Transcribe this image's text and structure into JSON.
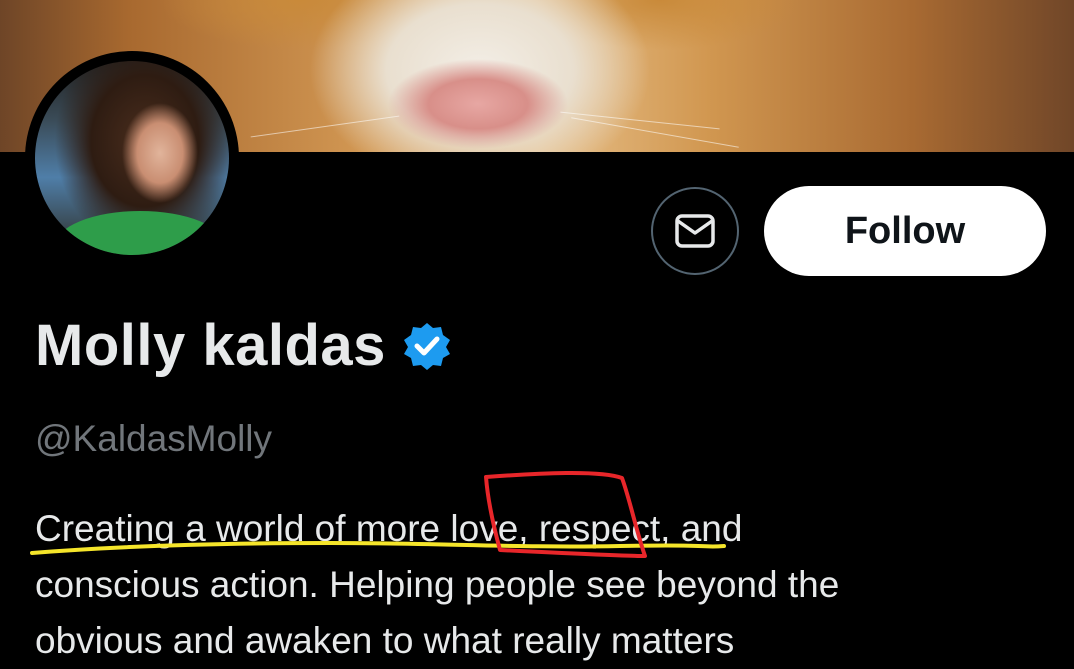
{
  "profile": {
    "display_name": "Molly kaldas",
    "handle": "@KaldasMolly",
    "bio_lines": [
      "Creating a world of more love, respect, and",
      "conscious action. Helping people see beyond the",
      "obvious and awaken to what really matters"
    ],
    "verified": true
  },
  "actions": {
    "follow_label": "Follow",
    "message_icon": "envelope-icon"
  },
  "colors": {
    "background": "#000000",
    "verified_badge": "#1d9bf0",
    "annotation_underline": "#f5e52a",
    "annotation_box": "#e8262a"
  }
}
